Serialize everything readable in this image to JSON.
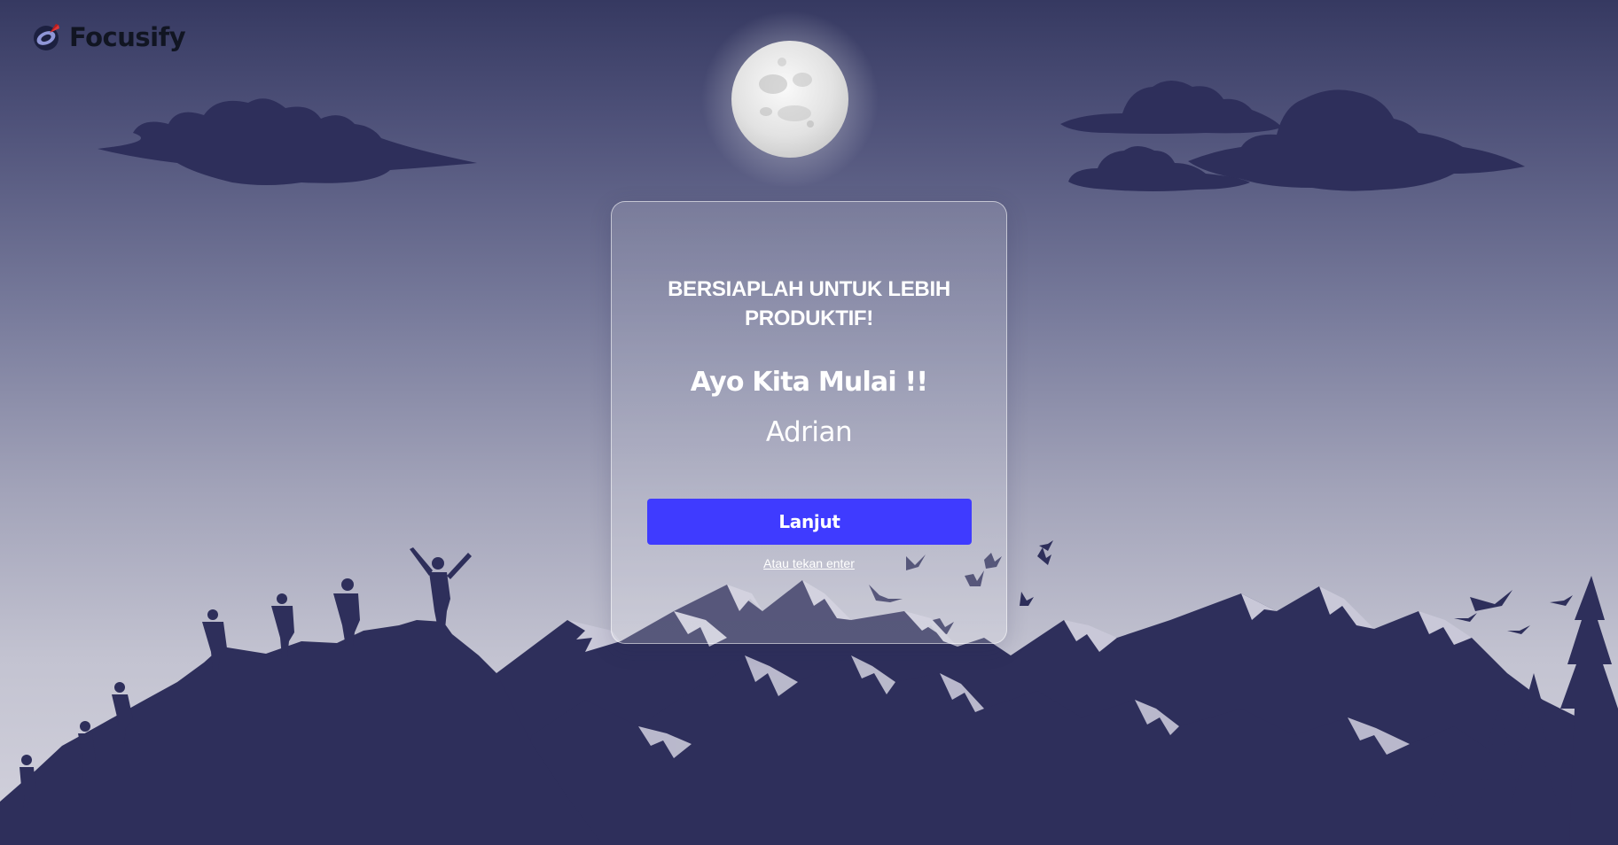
{
  "app": {
    "name": "Focusify",
    "logo_icon": "compass-icon"
  },
  "card": {
    "heading": "BERSIAPLAH UNTUK LEBIH PRODUKTIF!",
    "greeting": "Ayo Kita Mulai !!",
    "user_name": "Adrian",
    "continue_label": "Lanjut",
    "enter_hint": "Atau tekan enter"
  },
  "colors": {
    "primary_button": "#3f3bff",
    "silhouette": "#2e2f5b",
    "sky_top": "#363961",
    "sky_bottom": "#d3d2dd"
  }
}
